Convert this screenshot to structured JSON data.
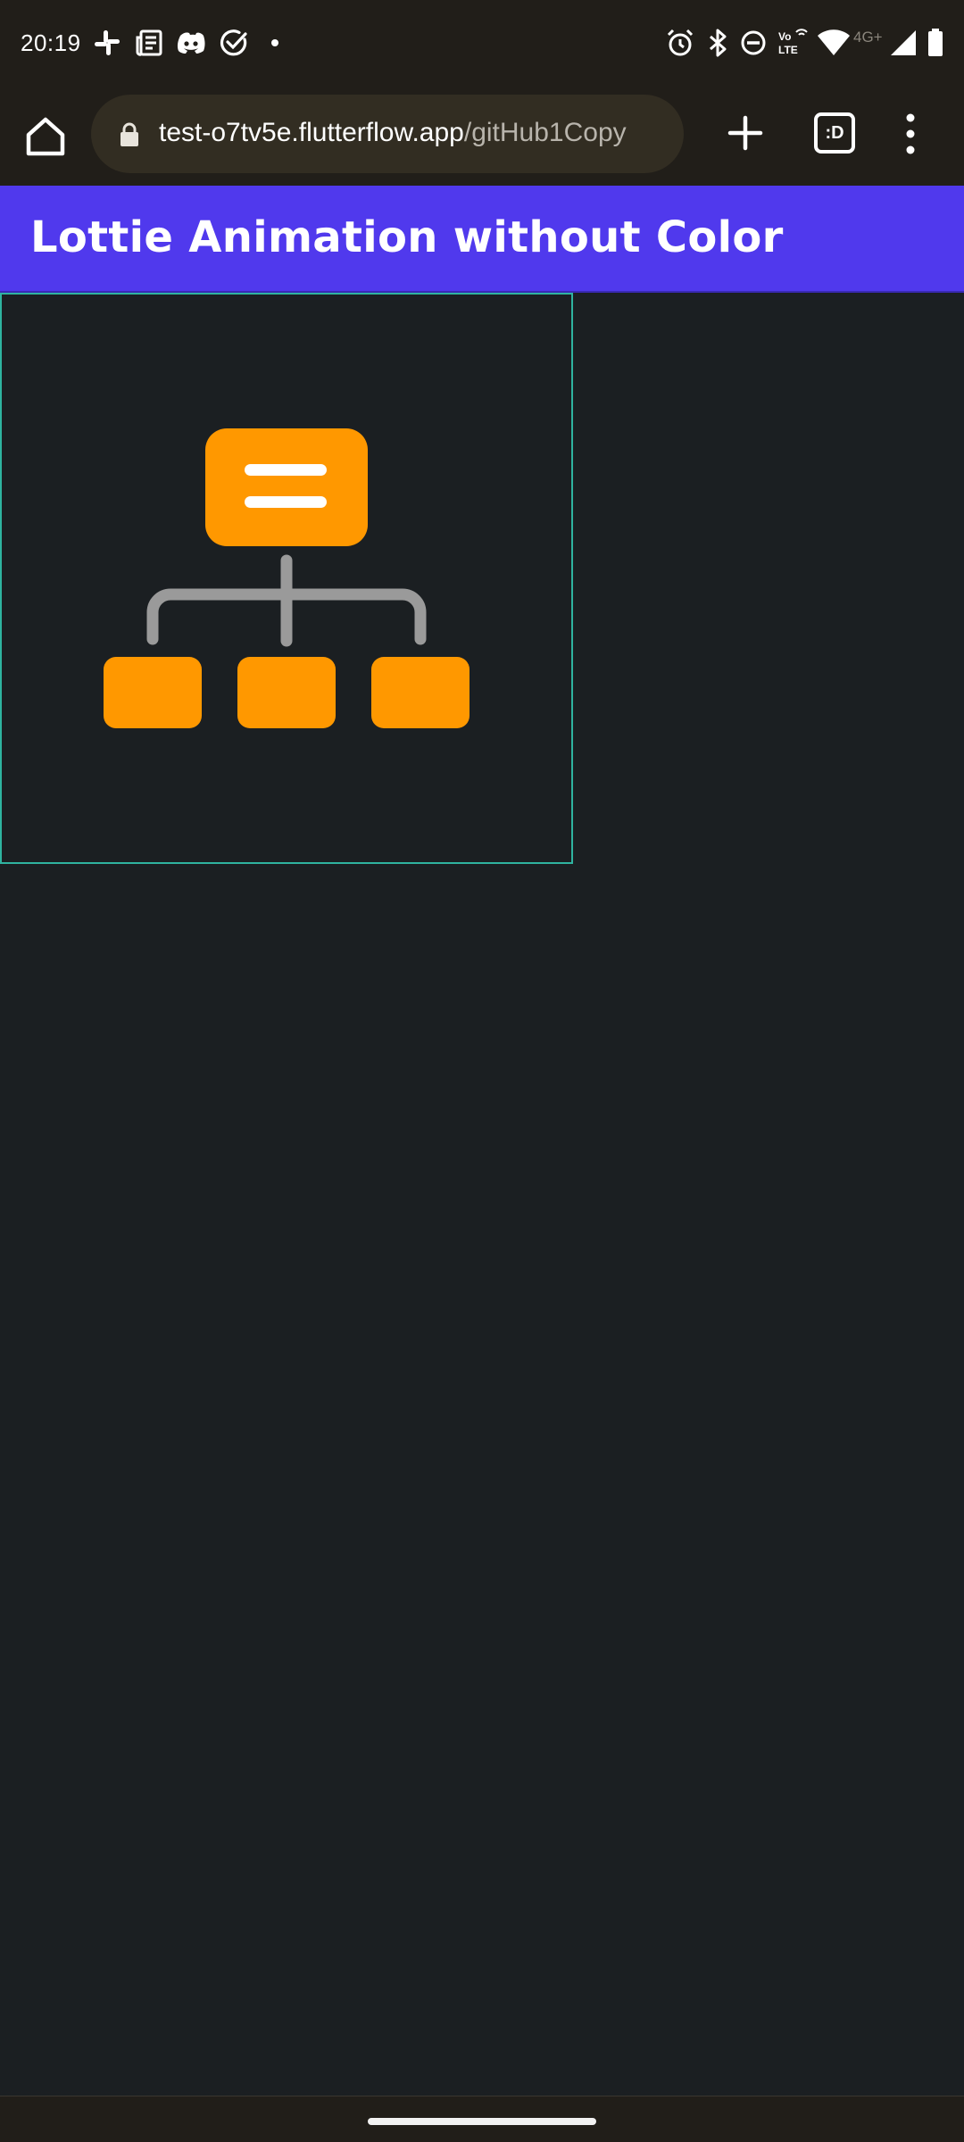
{
  "status_bar": {
    "time": "20:19",
    "left_icons": [
      "slack-icon",
      "news-icon",
      "discord-icon",
      "check-circle-icon",
      "dot-icon"
    ],
    "right_icons": [
      "alarm-icon",
      "bluetooth-icon",
      "do-not-disturb-icon",
      "volte-icon",
      "wifi-icon",
      "signal-icon",
      "battery-icon"
    ],
    "network_label": "4G+",
    "volte_label": "Vo LTE"
  },
  "browser": {
    "url_domain": "test-o7tv5e.flutterflow.app",
    "url_path": "/gitHub1Copy",
    "tabs_label": ":D",
    "icons": [
      "home-icon",
      "lock-icon",
      "plus-icon",
      "tabs-icon",
      "more-vert-icon"
    ]
  },
  "app_bar": {
    "title": "Lottie Animation without Color",
    "color": "#5039ed"
  },
  "lottie": {
    "icon": "org-chart-icon",
    "accent_color": "#ff9800",
    "line_color": "#9a9a9a",
    "border_color": "#2fb3a0"
  }
}
